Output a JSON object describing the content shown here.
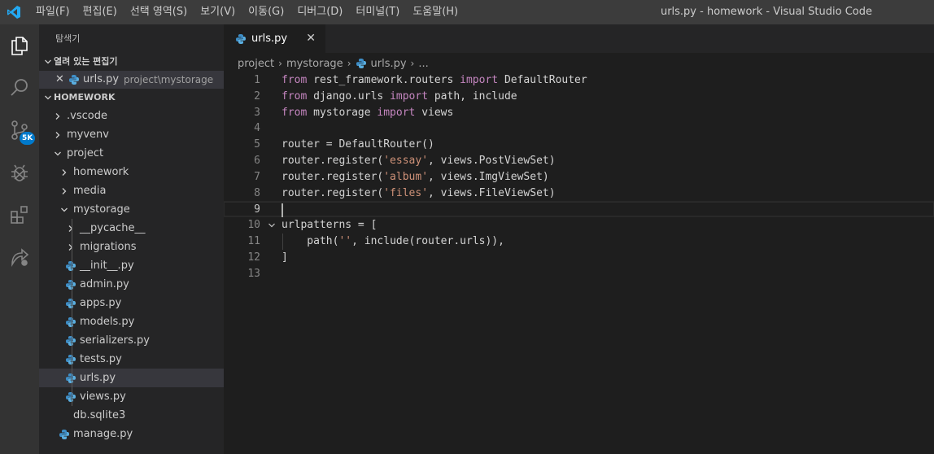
{
  "menu": {
    "items": [
      "파일(F)",
      "편집(E)",
      "선택 영역(S)",
      "보기(V)",
      "이동(G)",
      "디버그(D)",
      "터미널(T)",
      "도움말(H)"
    ]
  },
  "window_title": "urls.py - homework - Visual Studio Code",
  "activity": {
    "scm_badge": "5K"
  },
  "sidebar": {
    "title": "탐색기",
    "open_editors_header": "열려 있는 편집기",
    "open_editor": {
      "close": "✕",
      "name": "urls.py",
      "desc": "project\\mystorage"
    },
    "workspace_header": "HOMEWORK",
    "tree": [
      {
        "label": ".vscode",
        "type": "folder",
        "expanded": false,
        "depth": 0
      },
      {
        "label": "myvenv",
        "type": "folder",
        "expanded": false,
        "depth": 0
      },
      {
        "label": "project",
        "type": "folder",
        "expanded": true,
        "depth": 0
      },
      {
        "label": "homework",
        "type": "folder",
        "expanded": false,
        "depth": 1
      },
      {
        "label": "media",
        "type": "folder",
        "expanded": false,
        "depth": 1
      },
      {
        "label": "mystorage",
        "type": "folder",
        "expanded": true,
        "depth": 1
      },
      {
        "label": "__pycache__",
        "type": "folder",
        "expanded": false,
        "depth": 2
      },
      {
        "label": "migrations",
        "type": "folder",
        "expanded": false,
        "depth": 2
      },
      {
        "label": "__init__.py",
        "type": "py",
        "depth": 2
      },
      {
        "label": "admin.py",
        "type": "py",
        "depth": 2
      },
      {
        "label": "apps.py",
        "type": "py",
        "depth": 2
      },
      {
        "label": "models.py",
        "type": "py",
        "depth": 2
      },
      {
        "label": "serializers.py",
        "type": "py",
        "depth": 2
      },
      {
        "label": "tests.py",
        "type": "py",
        "depth": 2
      },
      {
        "label": "urls.py",
        "type": "py",
        "depth": 2,
        "selected": true
      },
      {
        "label": "views.py",
        "type": "py",
        "depth": 2
      },
      {
        "label": "db.sqlite3",
        "type": "file",
        "depth": 1
      },
      {
        "label": "manage.py",
        "type": "py",
        "depth": 1
      }
    ]
  },
  "tab": {
    "label": "urls.py",
    "close": "✕"
  },
  "breadcrumb": {
    "parts": [
      "project",
      "mystorage"
    ],
    "file": "urls.py",
    "more": "..."
  },
  "editor": {
    "current_line": 9,
    "lines": [
      [
        {
          "t": "from",
          "c": "kw"
        },
        {
          "t": " rest_framework.routers "
        },
        {
          "t": "import",
          "c": "kw"
        },
        {
          "t": " DefaultRouter"
        }
      ],
      [
        {
          "t": "from",
          "c": "kw"
        },
        {
          "t": " django.urls "
        },
        {
          "t": "import",
          "c": "kw"
        },
        {
          "t": " path, include"
        }
      ],
      [
        {
          "t": "from",
          "c": "kw"
        },
        {
          "t": " mystorage "
        },
        {
          "t": "import",
          "c": "kw"
        },
        {
          "t": " views"
        }
      ],
      [],
      [
        {
          "t": "router = DefaultRouter()"
        }
      ],
      [
        {
          "t": "router.register("
        },
        {
          "t": "'essay'",
          "c": "str"
        },
        {
          "t": ", views.PostViewSet)"
        }
      ],
      [
        {
          "t": "router.register("
        },
        {
          "t": "'album'",
          "c": "str"
        },
        {
          "t": ", views.ImgViewSet)"
        }
      ],
      [
        {
          "t": "router.register("
        },
        {
          "t": "'files'",
          "c": "str"
        },
        {
          "t": ", views.FileViewSet)"
        }
      ],
      [],
      [
        {
          "t": "urlpatterns = ["
        }
      ],
      [
        {
          "t": "    path("
        },
        {
          "t": "''",
          "c": "str"
        },
        {
          "t": ", include(router.urls)),"
        }
      ],
      [
        {
          "t": "]"
        }
      ],
      []
    ]
  }
}
